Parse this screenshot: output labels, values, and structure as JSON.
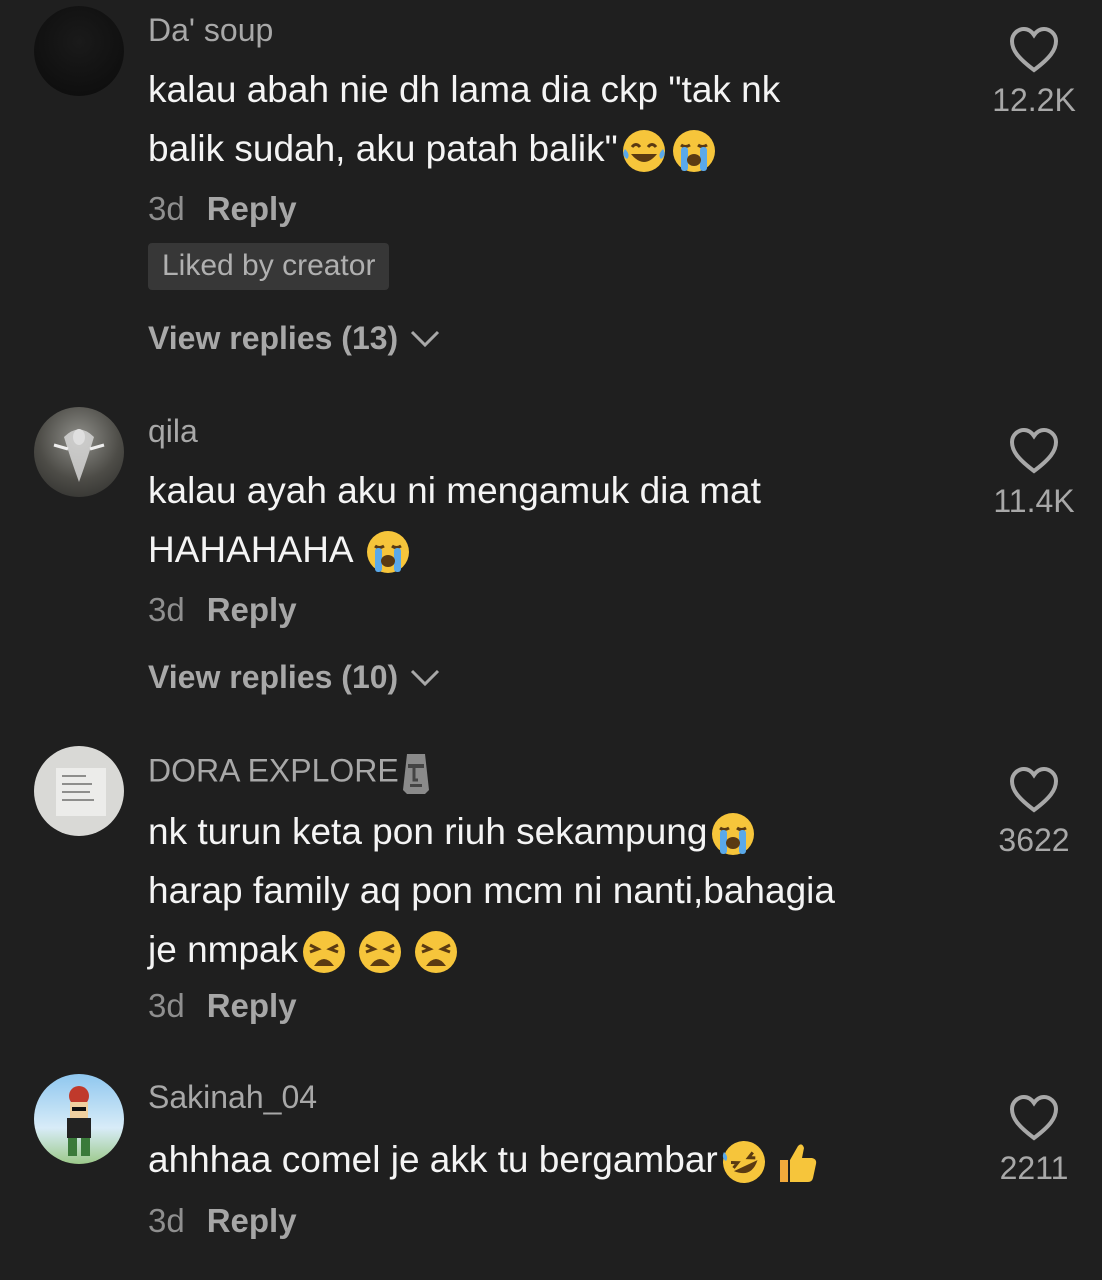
{
  "comments": [
    {
      "username": "Da' soup",
      "text_lines": [
        "kalau abah nie dh lama dia ckp \"tak nk",
        "balik sudah, aku patah balik\""
      ],
      "emojis_line2": [
        "laughing-crying-emoji",
        "loudly-crying-emoji"
      ],
      "time": "3d",
      "reply_label": "Reply",
      "liked_by_creator": "Liked by creator",
      "view_replies": "View replies (13)",
      "likes": "12.2K"
    },
    {
      "username": "qila",
      "text_lines": [
        "kalau ayah aku ni mengamuk dia mat",
        "HAHAHAHA "
      ],
      "emojis_line2": [
        "loudly-crying-emoji"
      ],
      "time": "3d",
      "reply_label": "Reply",
      "view_replies": "View replies (10)",
      "likes": "11.4K"
    },
    {
      "username": "DORA EXPLORE",
      "username_emoji": "moai-emoji",
      "text_lines": [
        "nk turun keta pon riuh sekampung",
        "harap family aq pon mcm ni nanti,bahagia",
        "je nmpak"
      ],
      "time": "3d",
      "reply_label": "Reply",
      "likes": "3622"
    },
    {
      "username": "Sakinah_04",
      "text_lines": [
        "ahhhaa comel je akk tu bergambar"
      ],
      "time": "3d",
      "reply_label": "Reply",
      "likes": "2211"
    }
  ],
  "colors": {
    "background": "#1f1f1f",
    "username": "#a8a8a8",
    "text": "#f4f4f4",
    "meta": "#8f8f8f"
  }
}
